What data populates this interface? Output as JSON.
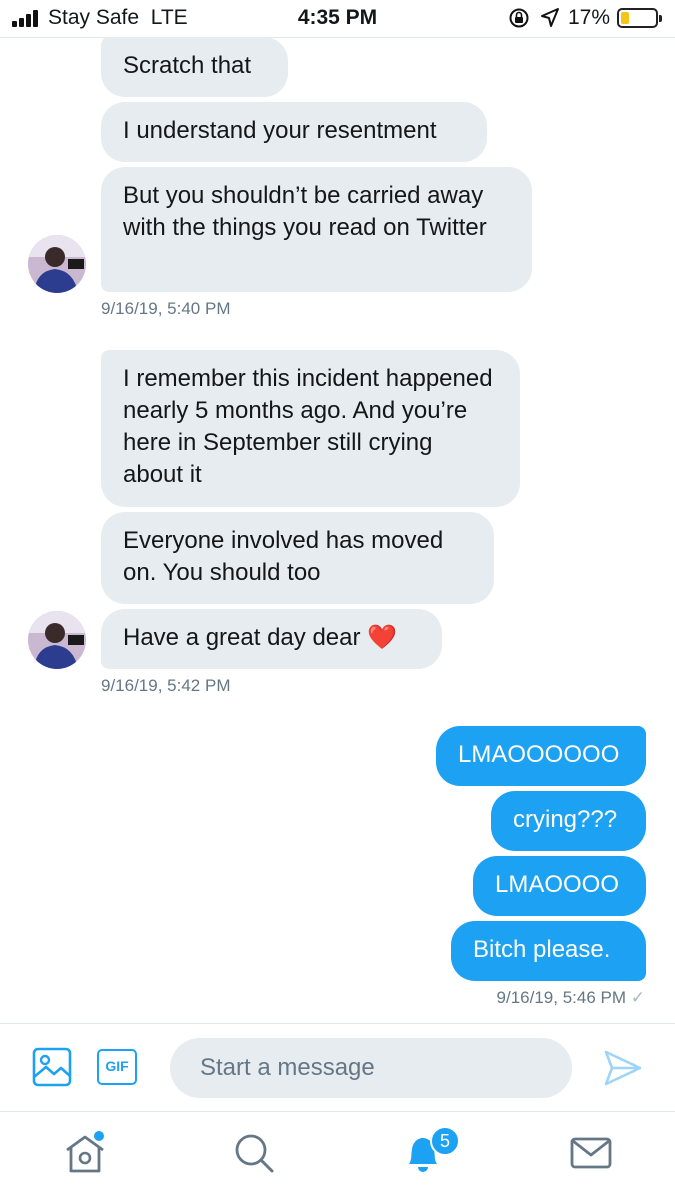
{
  "status_bar": {
    "carrier": "Stay Safe",
    "network": "LTE",
    "time": "4:35 PM",
    "battery": "17%",
    "battery_level": 0.17,
    "battery_color": "#f5c518"
  },
  "conversation": {
    "group1": {
      "messages": [
        "Scratch that",
        "I understand your resentment",
        "But you shouldn’t be carried away with the things you read on Twitter"
      ],
      "timestamp": "9/16/19, 5:40 PM"
    },
    "group2": {
      "messages": [
        "I remember this incident happened nearly 5 months ago. And you’re here in September still crying about it",
        "Everyone involved has moved on. You should too",
        "Have a great day dear ❤️"
      ],
      "timestamp": "9/16/19, 5:42 PM"
    },
    "group3": {
      "messages": [
        "LMAOOOOOO",
        "crying???",
        "LMAOOOO",
        "Bitch please."
      ],
      "timestamp": "9/16/19, 5:46 PM",
      "read_mark": "✓"
    }
  },
  "composer": {
    "gif_label": "GIF",
    "placeholder": "Start a message",
    "icons": [
      "image-icon",
      "gif-icon",
      "send-icon"
    ]
  },
  "tab_bar": {
    "items": [
      "home-icon",
      "search-icon",
      "notifications-icon",
      "messages-icon"
    ],
    "notifications_badge": "5"
  },
  "colors": {
    "accent": "#1da1f2",
    "incoming_bubble": "#e6ecf0",
    "timestamp_text": "#657786"
  }
}
